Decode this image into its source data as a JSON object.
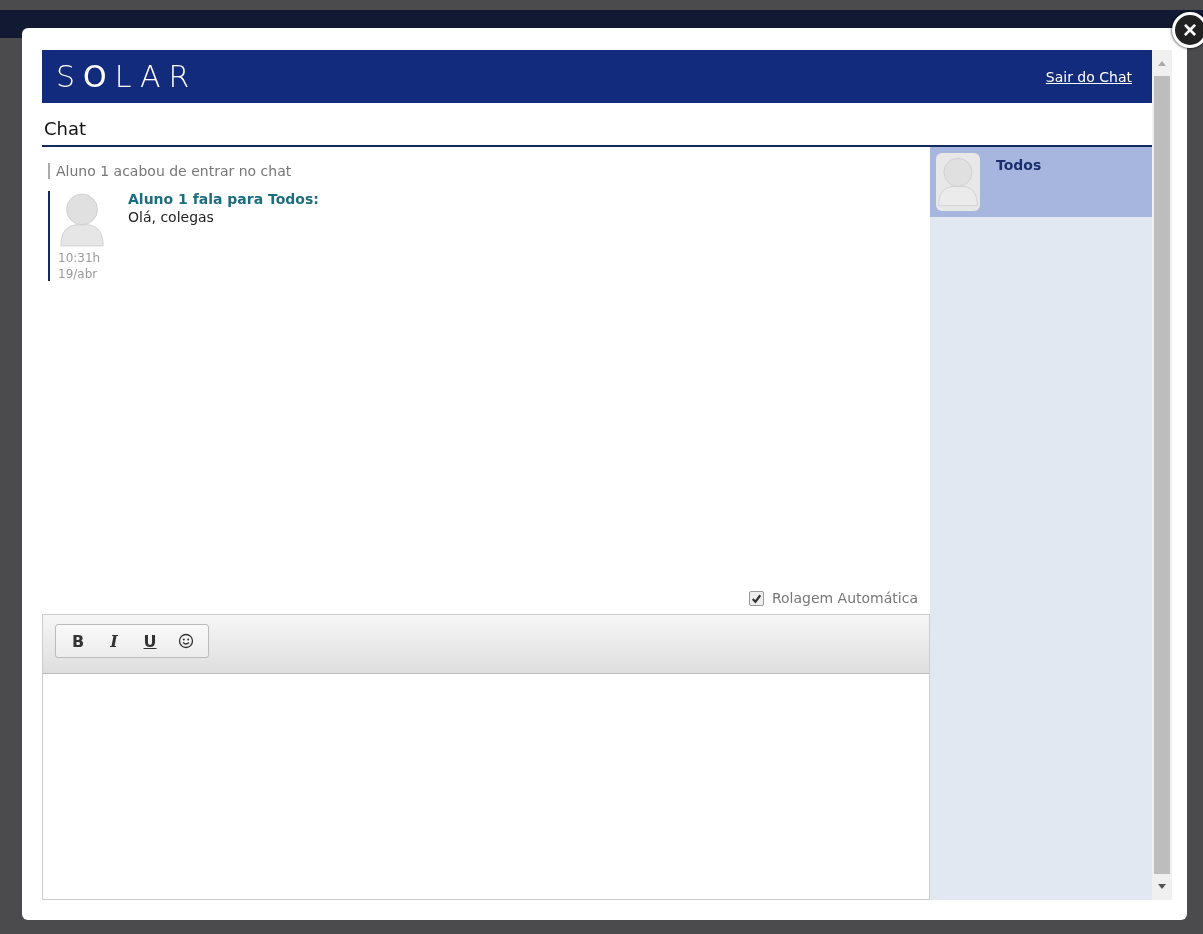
{
  "close_button": "×",
  "header": {
    "logo": "S**O**LAR",
    "exit_link": "Sair do Chat"
  },
  "title": "Chat",
  "messages": [
    {
      "kind": "system",
      "text": "Aluno 1 acabou de entrar no chat"
    },
    {
      "kind": "message",
      "author_line": "Aluno 1 fala para Todos:",
      "text": "Olá, colegas",
      "time": "10:31h",
      "date": "19/abr"
    }
  ],
  "auto_scroll": {
    "label": "Rolagem Automática",
    "checked": true
  },
  "editor_toolbar": [
    {
      "kind": "bold",
      "label": "B"
    },
    {
      "kind": "italic",
      "label": "I"
    },
    {
      "kind": "underline",
      "label": "U"
    },
    {
      "kind": "emoji"
    }
  ],
  "users": [
    {
      "name": "Todos",
      "selected": true
    }
  ]
}
